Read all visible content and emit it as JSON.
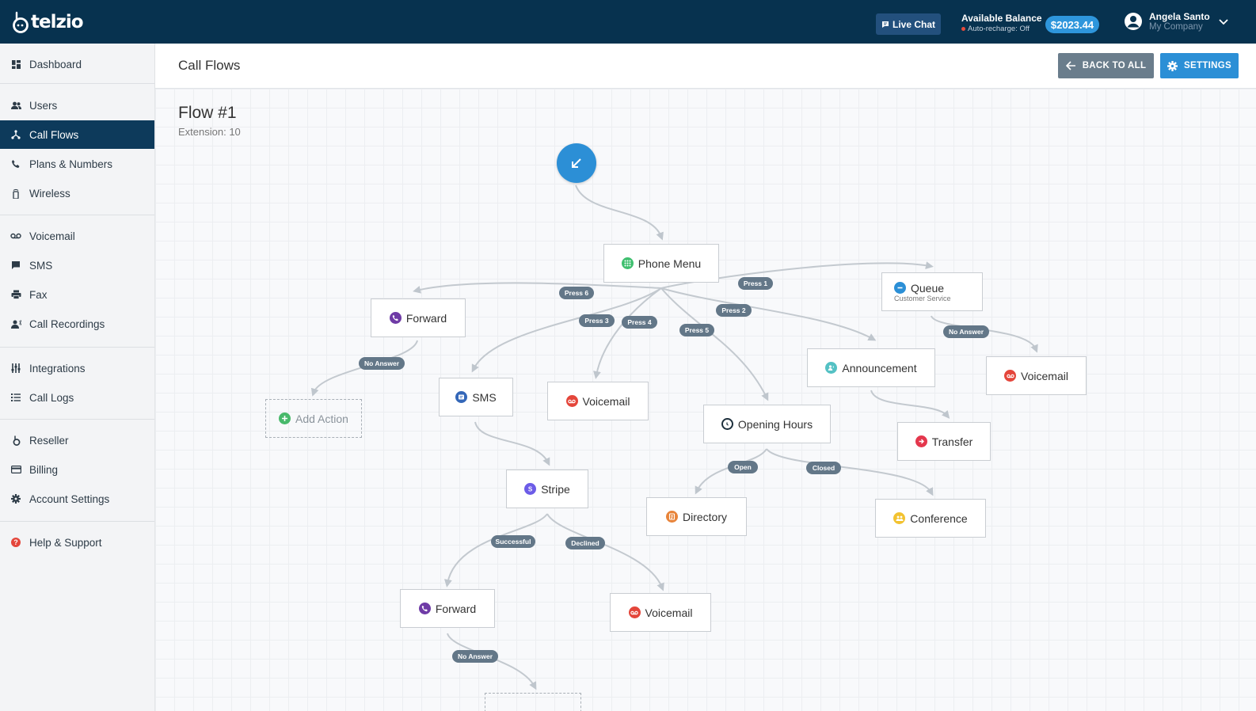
{
  "app": {
    "brand": "telzio",
    "live_chat": "Live Chat",
    "balance_label": "Available Balance",
    "auto_recharge": "Auto-recharge: Off",
    "balance_amount": "$2023.44",
    "user_name": "Angela Santo",
    "user_company": "My Company"
  },
  "sidebar": {
    "items": [
      {
        "label": "Dashboard",
        "icon": "dashboard-icon"
      },
      {
        "label": "Users",
        "icon": "users-icon"
      },
      {
        "label": "Call Flows",
        "icon": "call-flows-icon"
      },
      {
        "label": "Plans & Numbers",
        "icon": "phone-icon"
      },
      {
        "label": "Wireless",
        "icon": "wireless-icon"
      },
      {
        "label": "Voicemail",
        "icon": "voicemail-icon"
      },
      {
        "label": "SMS",
        "icon": "sms-icon"
      },
      {
        "label": "Fax",
        "icon": "fax-icon"
      },
      {
        "label": "Call Recordings",
        "icon": "recordings-icon"
      },
      {
        "label": "Integrations",
        "icon": "integrations-icon"
      },
      {
        "label": "Call Logs",
        "icon": "list-icon"
      },
      {
        "label": "Reseller",
        "icon": "reseller-icon"
      },
      {
        "label": "Billing",
        "icon": "billing-icon"
      },
      {
        "label": "Account Settings",
        "icon": "gear-icon"
      },
      {
        "label": "Help & Support",
        "icon": "help-icon"
      }
    ]
  },
  "header": {
    "title": "Call Flows",
    "back_label": "BACK TO ALL",
    "settings_label": "SETTINGS"
  },
  "flow": {
    "name": "Flow #1",
    "extension": "Extension: 10",
    "nodes": {
      "phone_menu": "Phone Menu",
      "forward1": "Forward",
      "add_action": "Add Action",
      "queue": "Queue",
      "queue_sub": "Customer Service",
      "sms": "SMS",
      "voicemail1": "Voicemail",
      "opening_hours": "Opening Hours",
      "announcement": "Announcement",
      "voicemail2": "Voicemail",
      "transfer": "Transfer",
      "stripe": "Stripe",
      "directory": "Directory",
      "conference": "Conference",
      "forward2": "Forward",
      "voicemail3": "Voicemail"
    },
    "labels": {
      "press1": "Press 1",
      "press2": "Press 2",
      "press3": "Press 3",
      "press4": "Press 4",
      "press5": "Press 5",
      "press6": "Press 6",
      "no_answer1": "No Answer",
      "no_answer2": "No Answer",
      "no_answer3": "No Answer",
      "open": "Open",
      "closed": "Closed",
      "successful": "Successful",
      "declined": "Declined"
    }
  },
  "colors": {
    "topbar": "#07324f",
    "active_nav": "#0d3a5b",
    "primary": "#2b8fd6",
    "pill": "#637788"
  }
}
